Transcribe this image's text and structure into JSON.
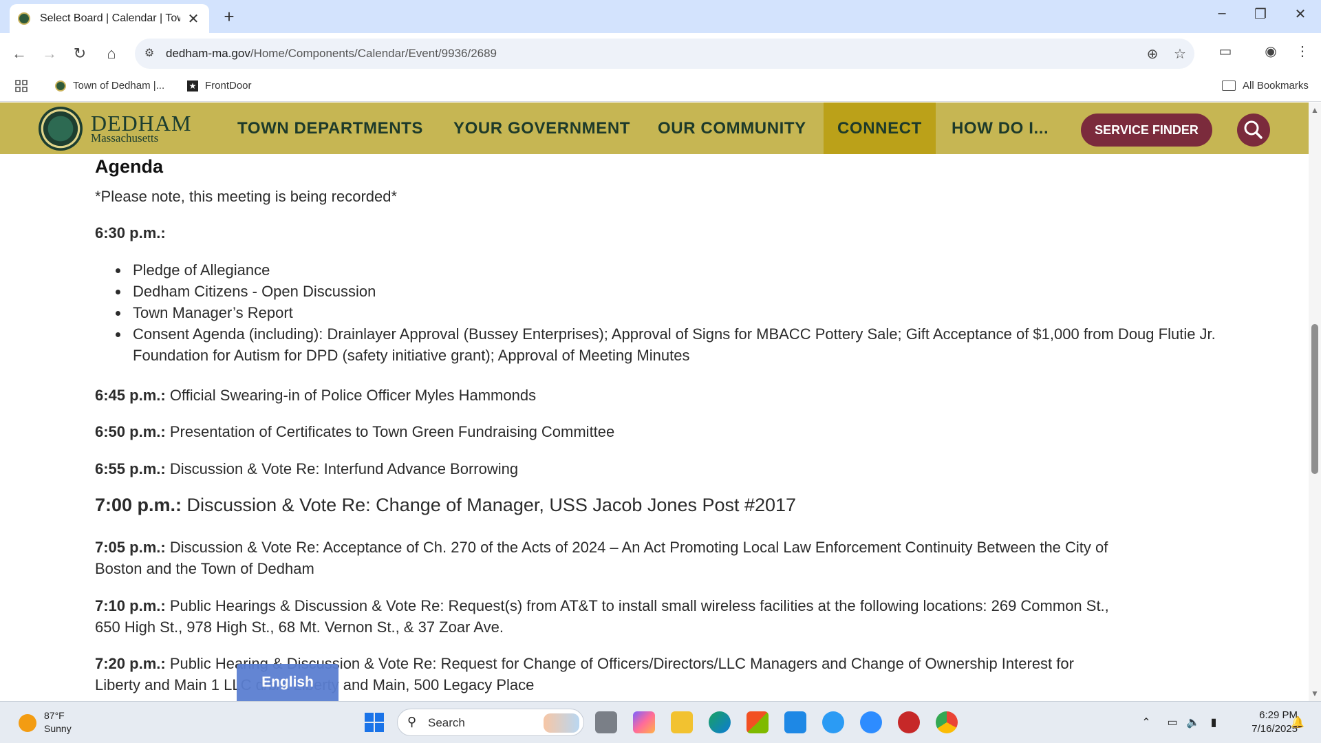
{
  "browser": {
    "tab_title": "Select Board | Calendar | Town of Dedham",
    "tab_close": "✕",
    "new_tab": "+",
    "url_host": "dedham-ma.gov",
    "url_path": "/Home/Components/Calendar/Event/9936/2689",
    "bookmarks": [
      {
        "label": "Town of Dedham |..."
      },
      {
        "label": "FrontDoor"
      }
    ],
    "all_bookmarks": "All Bookmarks"
  },
  "site": {
    "brand_name": "DEDHAM",
    "brand_sub": "Massachusetts",
    "nav": [
      {
        "label": "TOWN DEPARTMENTS"
      },
      {
        "label": "YOUR GOVERNMENT"
      },
      {
        "label": "OUR COMMUNITY"
      },
      {
        "label": "CONNECT"
      },
      {
        "label": "HOW DO I..."
      }
    ],
    "service_finder": "SERVICE FINDER",
    "accent_color": "#c6b653",
    "button_color": "#7b2b3c"
  },
  "agenda": {
    "heading": "Agenda",
    "note": "*Please note, this meeting is being recorded*",
    "first_time": "6:30 p.m.:",
    "items": [
      "Pledge of Allegiance",
      "Dedham Citizens - Open Discussion",
      "Town Manager’s Report",
      "Consent Agenda (including): Drainlayer Approval (Bussey Enterprises); Approval of Signs for MBACC Pottery Sale; Gift Acceptance of $1,000 from Doug Flutie Jr. Foundation for Autism for DPD (safety initiative grant); Approval of Meeting Minutes"
    ],
    "entries": [
      {
        "time": "6:45 p.m.:",
        "text": " Official Swearing-in of Police Officer Myles Hammonds"
      },
      {
        "time": "6:50 p.m.:",
        "text": " Presentation of Certificates to Town Green Fundraising Committee"
      },
      {
        "time": "6:55 p.m.:",
        "text": " Discussion & Vote Re: Interfund Advance Borrowing"
      },
      {
        "time": "7:00 p.m.:",
        "text": " Discussion & Vote Re: Change of Manager, USS Jacob Jones Post #2017"
      },
      {
        "time": "7:05 p.m.:",
        "text": " Discussion & Vote Re: Acceptance of Ch. 270 of the Acts of 2024 – An Act Promoting Local Law Enforcement Continuity Between the City of Boston and the Town of Dedham"
      },
      {
        "time": "7:10 p.m.:",
        "text": " Public Hearings & Discussion & Vote Re: Request(s) from AT&T to install small wireless facilities at the following locations: 269 Common St., 650 High St., 978 High St., 68 Mt. Vernon St., & 37 Zoar Ave."
      },
      {
        "time": "7:20 p.m.:",
        "text": " Public Hearing & Discussion & Vote Re: Request for Change of Officers/Directors/LLC Managers and Change of Ownership Interest for Liberty and Main 1 LLC d/b/a Liberty and Main, 500 Legacy Place"
      }
    ]
  },
  "language_button": "English",
  "taskbar": {
    "temperature": "87°F",
    "condition": "Sunny",
    "search_label": "Search",
    "time": "6:29 PM",
    "date": "7/16/2025"
  }
}
